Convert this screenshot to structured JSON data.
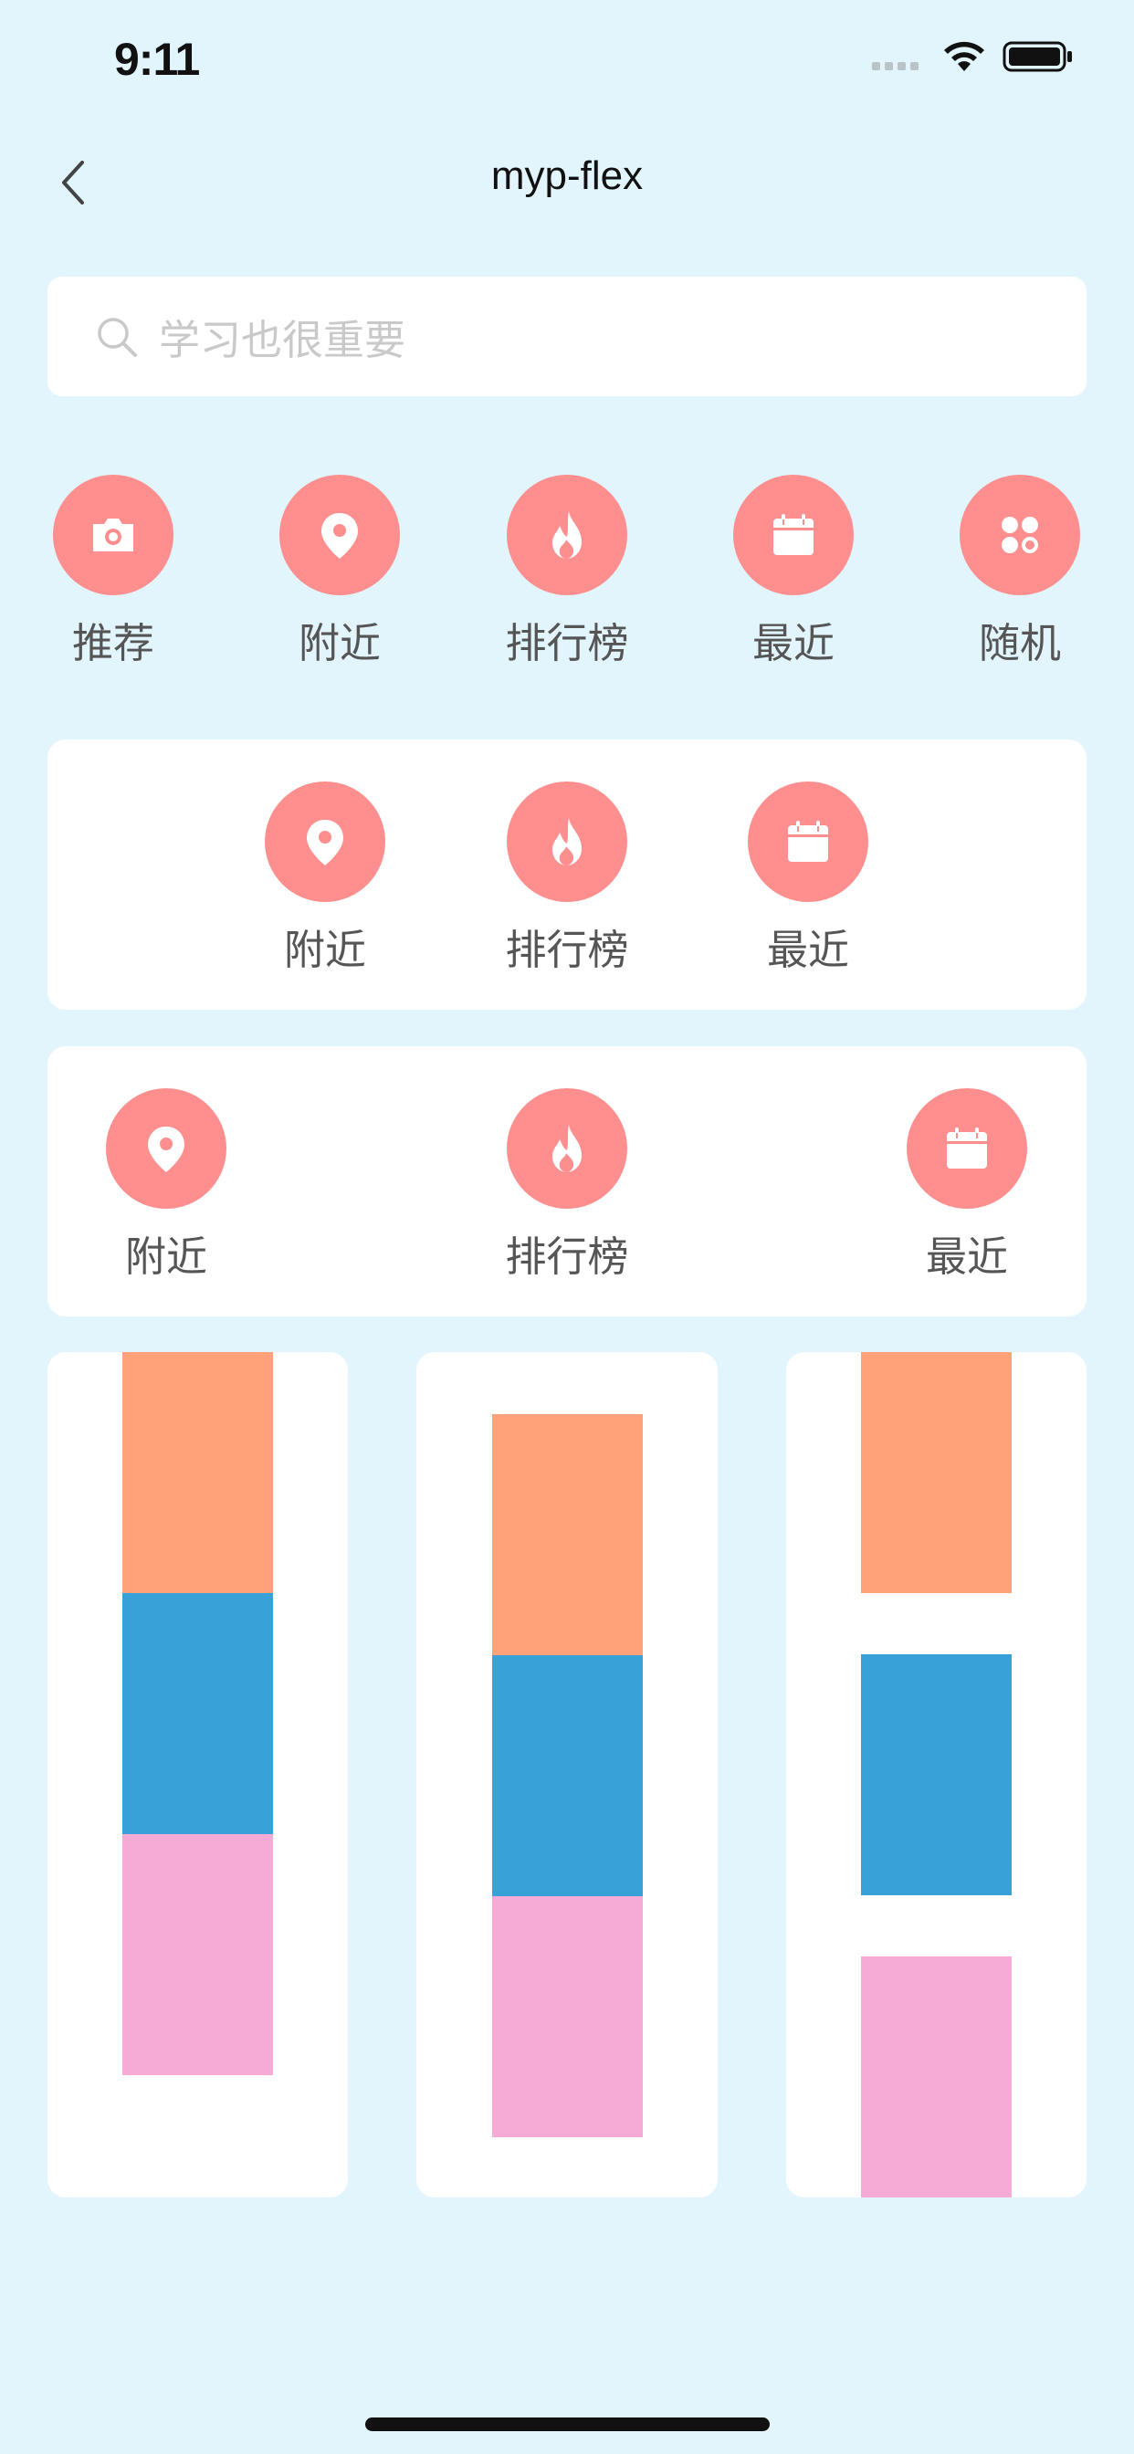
{
  "status": {
    "time": "9:11"
  },
  "nav": {
    "title": "myp-flex"
  },
  "search": {
    "placeholder": "学习也很重要"
  },
  "row1": [
    {
      "label": "推荐",
      "icon": "camera-icon"
    },
    {
      "label": "附近",
      "icon": "location-pin-icon"
    },
    {
      "label": "排行榜",
      "icon": "fire-icon"
    },
    {
      "label": "最近",
      "icon": "calendar-icon"
    },
    {
      "label": "随机",
      "icon": "grid-dots-icon"
    }
  ],
  "card_center": [
    {
      "label": "附近",
      "icon": "location-pin-icon"
    },
    {
      "label": "排行榜",
      "icon": "fire-icon"
    },
    {
      "label": "最近",
      "icon": "calendar-icon"
    }
  ],
  "card_between": [
    {
      "label": "附近",
      "icon": "location-pin-icon"
    },
    {
      "label": "排行榜",
      "icon": "fire-icon"
    },
    {
      "label": "最近",
      "icon": "calendar-icon"
    }
  ],
  "colors": {
    "background": "#e2f5fc",
    "accent": "#ff8e8e",
    "block_orange": "#ffa27a",
    "block_blue": "#38a1d7",
    "block_pink": "#f6aad6"
  }
}
